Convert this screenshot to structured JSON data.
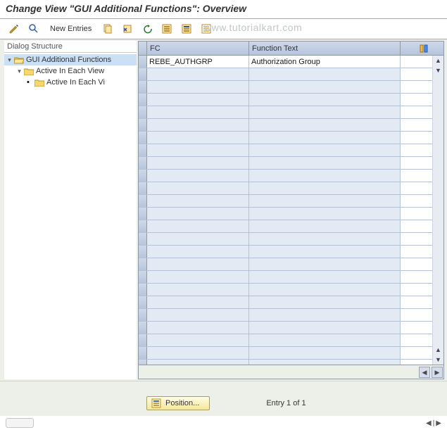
{
  "title": "Change View \"GUI Additional Functions\": Overview",
  "watermark": "www.tutorialkart.com",
  "toolbar": {
    "new_entries_label": "New Entries"
  },
  "sidebar": {
    "title": "Dialog Structure",
    "nodes": [
      {
        "label": "GUI Additional Functions",
        "selected": true,
        "open": true,
        "level": 0
      },
      {
        "label": "Active In Each View",
        "selected": false,
        "open": true,
        "level": 1
      },
      {
        "label": "Active In Each Vi",
        "selected": false,
        "open": false,
        "level": 2
      }
    ]
  },
  "table": {
    "columns": {
      "fc": "FC",
      "ft": "Function Text"
    },
    "rows": [
      {
        "fc": "REBE_AUTHGRP",
        "ft": "Authorization Group"
      }
    ],
    "empty_row_count": 24
  },
  "footer": {
    "position_label": "Position...",
    "entry_text": "Entry 1 of 1"
  }
}
